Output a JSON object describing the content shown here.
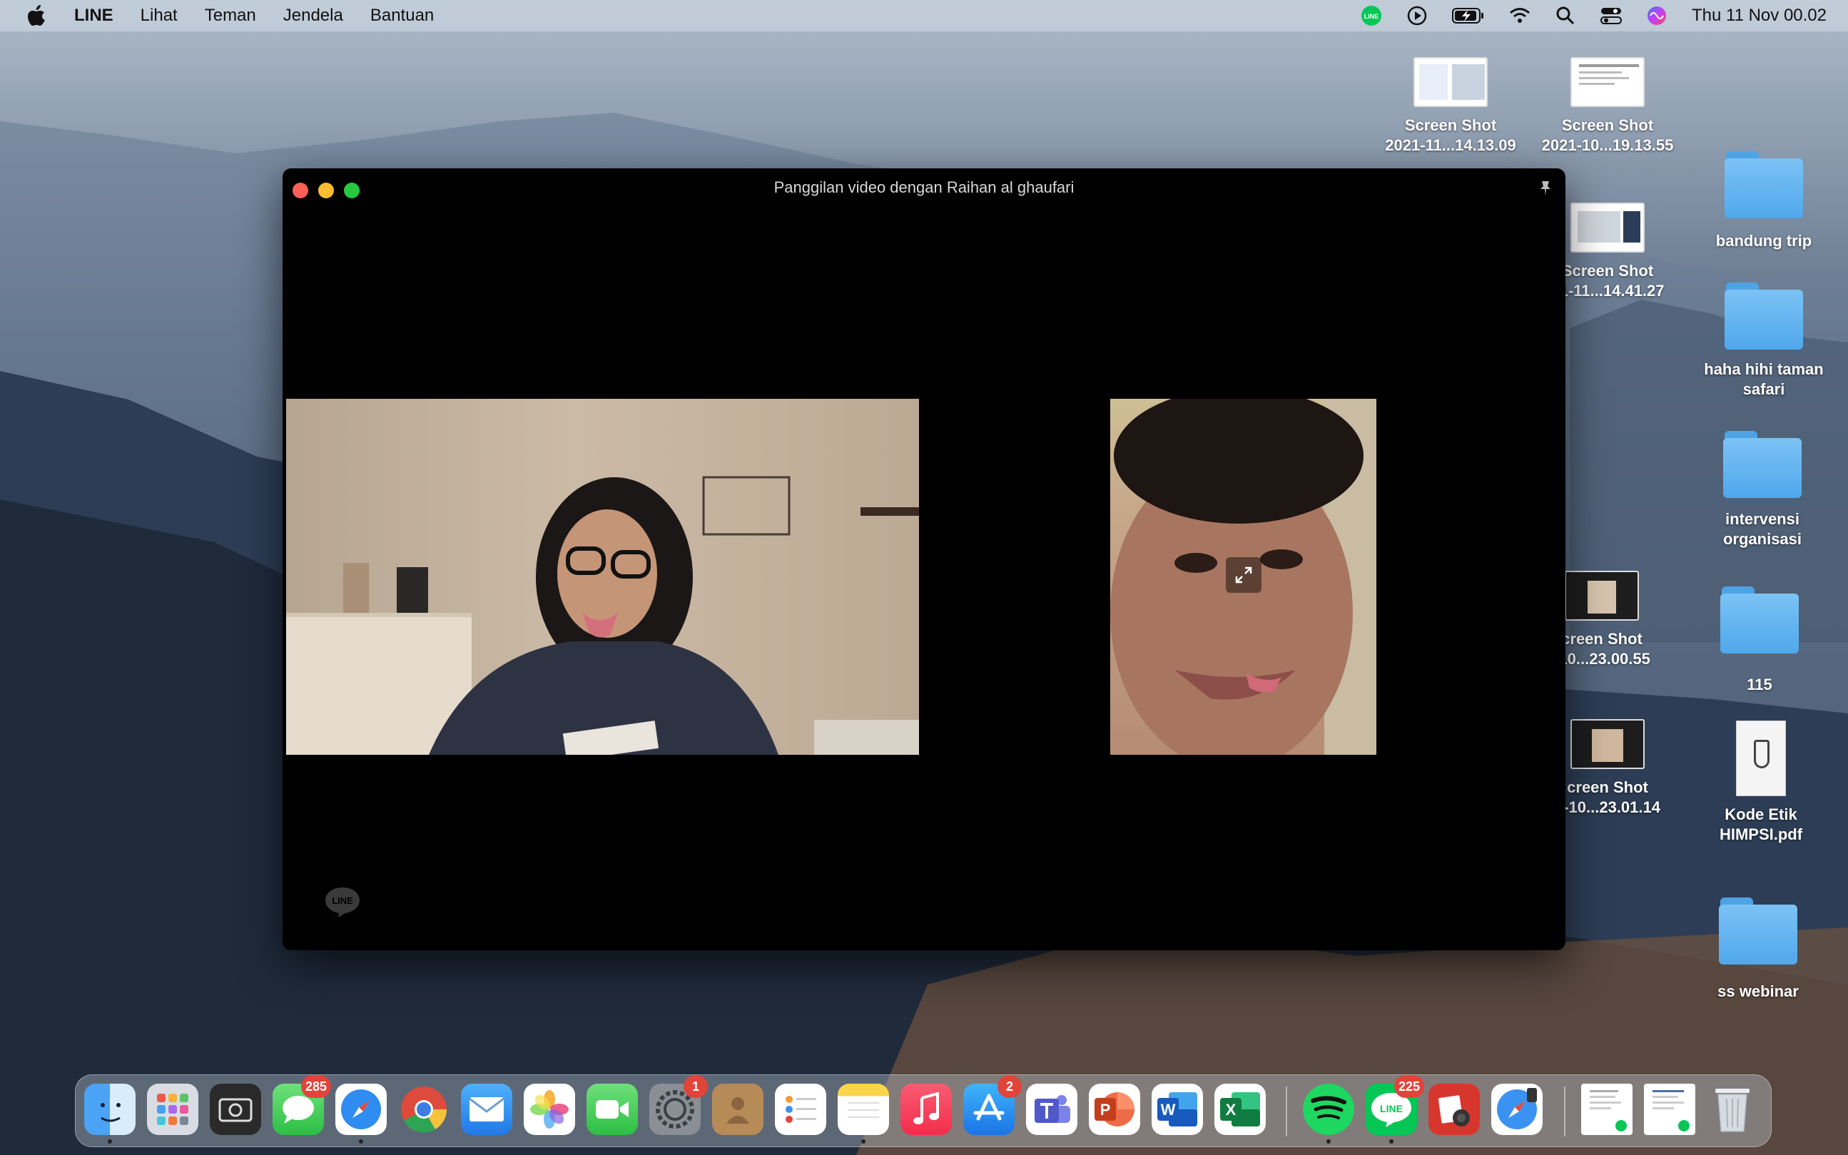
{
  "menubar": {
    "app_name": "LINE",
    "menus": [
      "Lihat",
      "Teman",
      "Jendela",
      "Bantuan"
    ],
    "clock": "Thu 11 Nov  00.02"
  },
  "desktop": {
    "items": [
      {
        "type": "screenshot",
        "line1": "Screen Shot",
        "line2": "2021-11...14.13.09"
      },
      {
        "type": "screenshot",
        "line1": "Screen Shot",
        "line2": "2021-10...19.13.55"
      },
      {
        "type": "screenshot",
        "line1": "Screen Shot",
        "line2": "21-11...14.41.27"
      },
      {
        "type": "screenshot",
        "line1": "creen Shot",
        "line2": "-10...23.00.55"
      },
      {
        "type": "screenshot",
        "line1": "creen Shot",
        "line2": "1-10...23.01.14"
      },
      {
        "type": "folder",
        "line1": "bandung trip",
        "line2": ""
      },
      {
        "type": "folder",
        "line1": "haha hihi taman",
        "line2": "safari"
      },
      {
        "type": "folder",
        "line1": "intervensi",
        "line2": "organisasi"
      },
      {
        "type": "folder",
        "line1": "115",
        "line2": ""
      },
      {
        "type": "pdf",
        "line1": "Kode Etik",
        "line2": "HIMPSI.pdf"
      },
      {
        "type": "folder",
        "line1": "ss webinar",
        "line2": ""
      }
    ]
  },
  "call_window": {
    "title": "Panggilan video dengan Raihan al ghaufari",
    "logo_text": "LINE"
  },
  "dock": {
    "apps": [
      "Finder",
      "Launchpad",
      "Screenshot",
      "Messages",
      "Safari",
      "Chrome",
      "Mail",
      "Photos",
      "FaceTime",
      "System Preferences",
      "Contacts",
      "Reminders",
      "Notes",
      "Music",
      "App Store",
      "Teams",
      "PowerPoint",
      "Word",
      "Excel",
      "Spotify",
      "LINE",
      "Photo Booth",
      "Safari",
      "Document 1",
      "Document 2",
      "Trash"
    ],
    "badges": {
      "messages": "285",
      "system_prefs": "1",
      "app_store": "2",
      "line": "225"
    },
    "letters": {
      "powerpoint": "P",
      "word": "W",
      "excel": "X",
      "line": "LINE"
    }
  }
}
